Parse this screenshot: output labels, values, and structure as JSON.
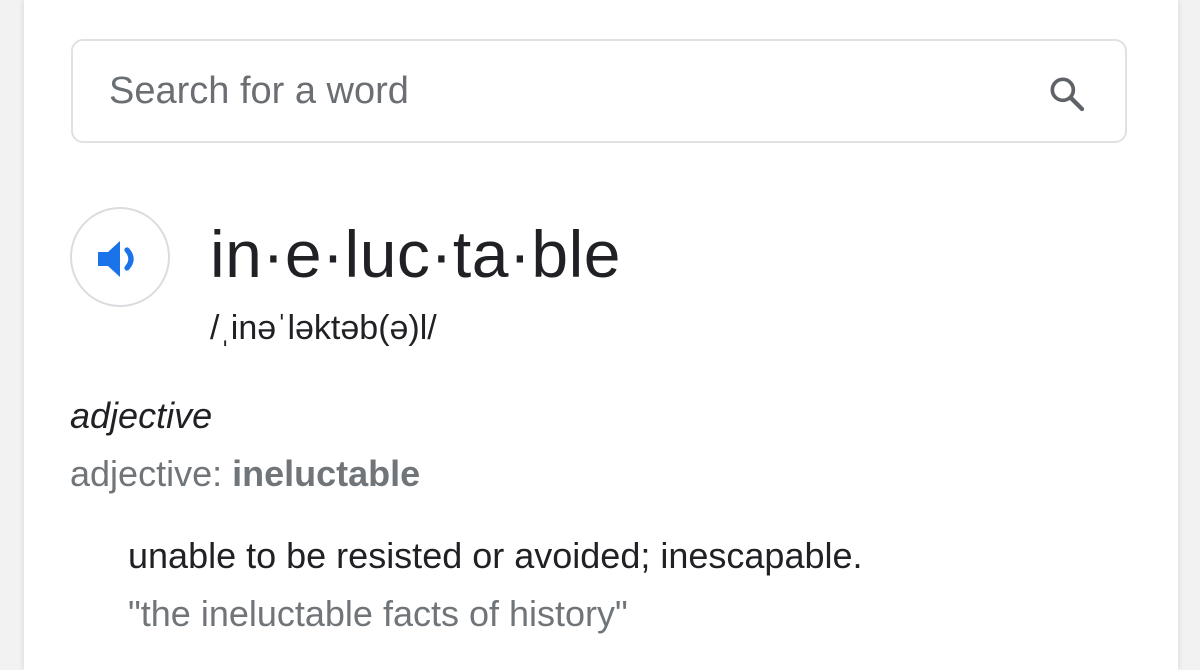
{
  "search": {
    "placeholder": "Search for a word",
    "value": "",
    "icon": "search-icon"
  },
  "entry": {
    "speaker_icon": "speaker-icon",
    "accent_color": "#1a73e8",
    "headword": "in·e·luc·ta·ble",
    "pronunciation": "/ˌinəˈləktəb(ə)l/",
    "part_of_speech": "adjective",
    "pos_label": "adjective: ",
    "pos_word": "ineluctable",
    "definition": "unable to be resisted or avoided; inescapable.",
    "example": "\"the ineluctable facts of history\""
  }
}
